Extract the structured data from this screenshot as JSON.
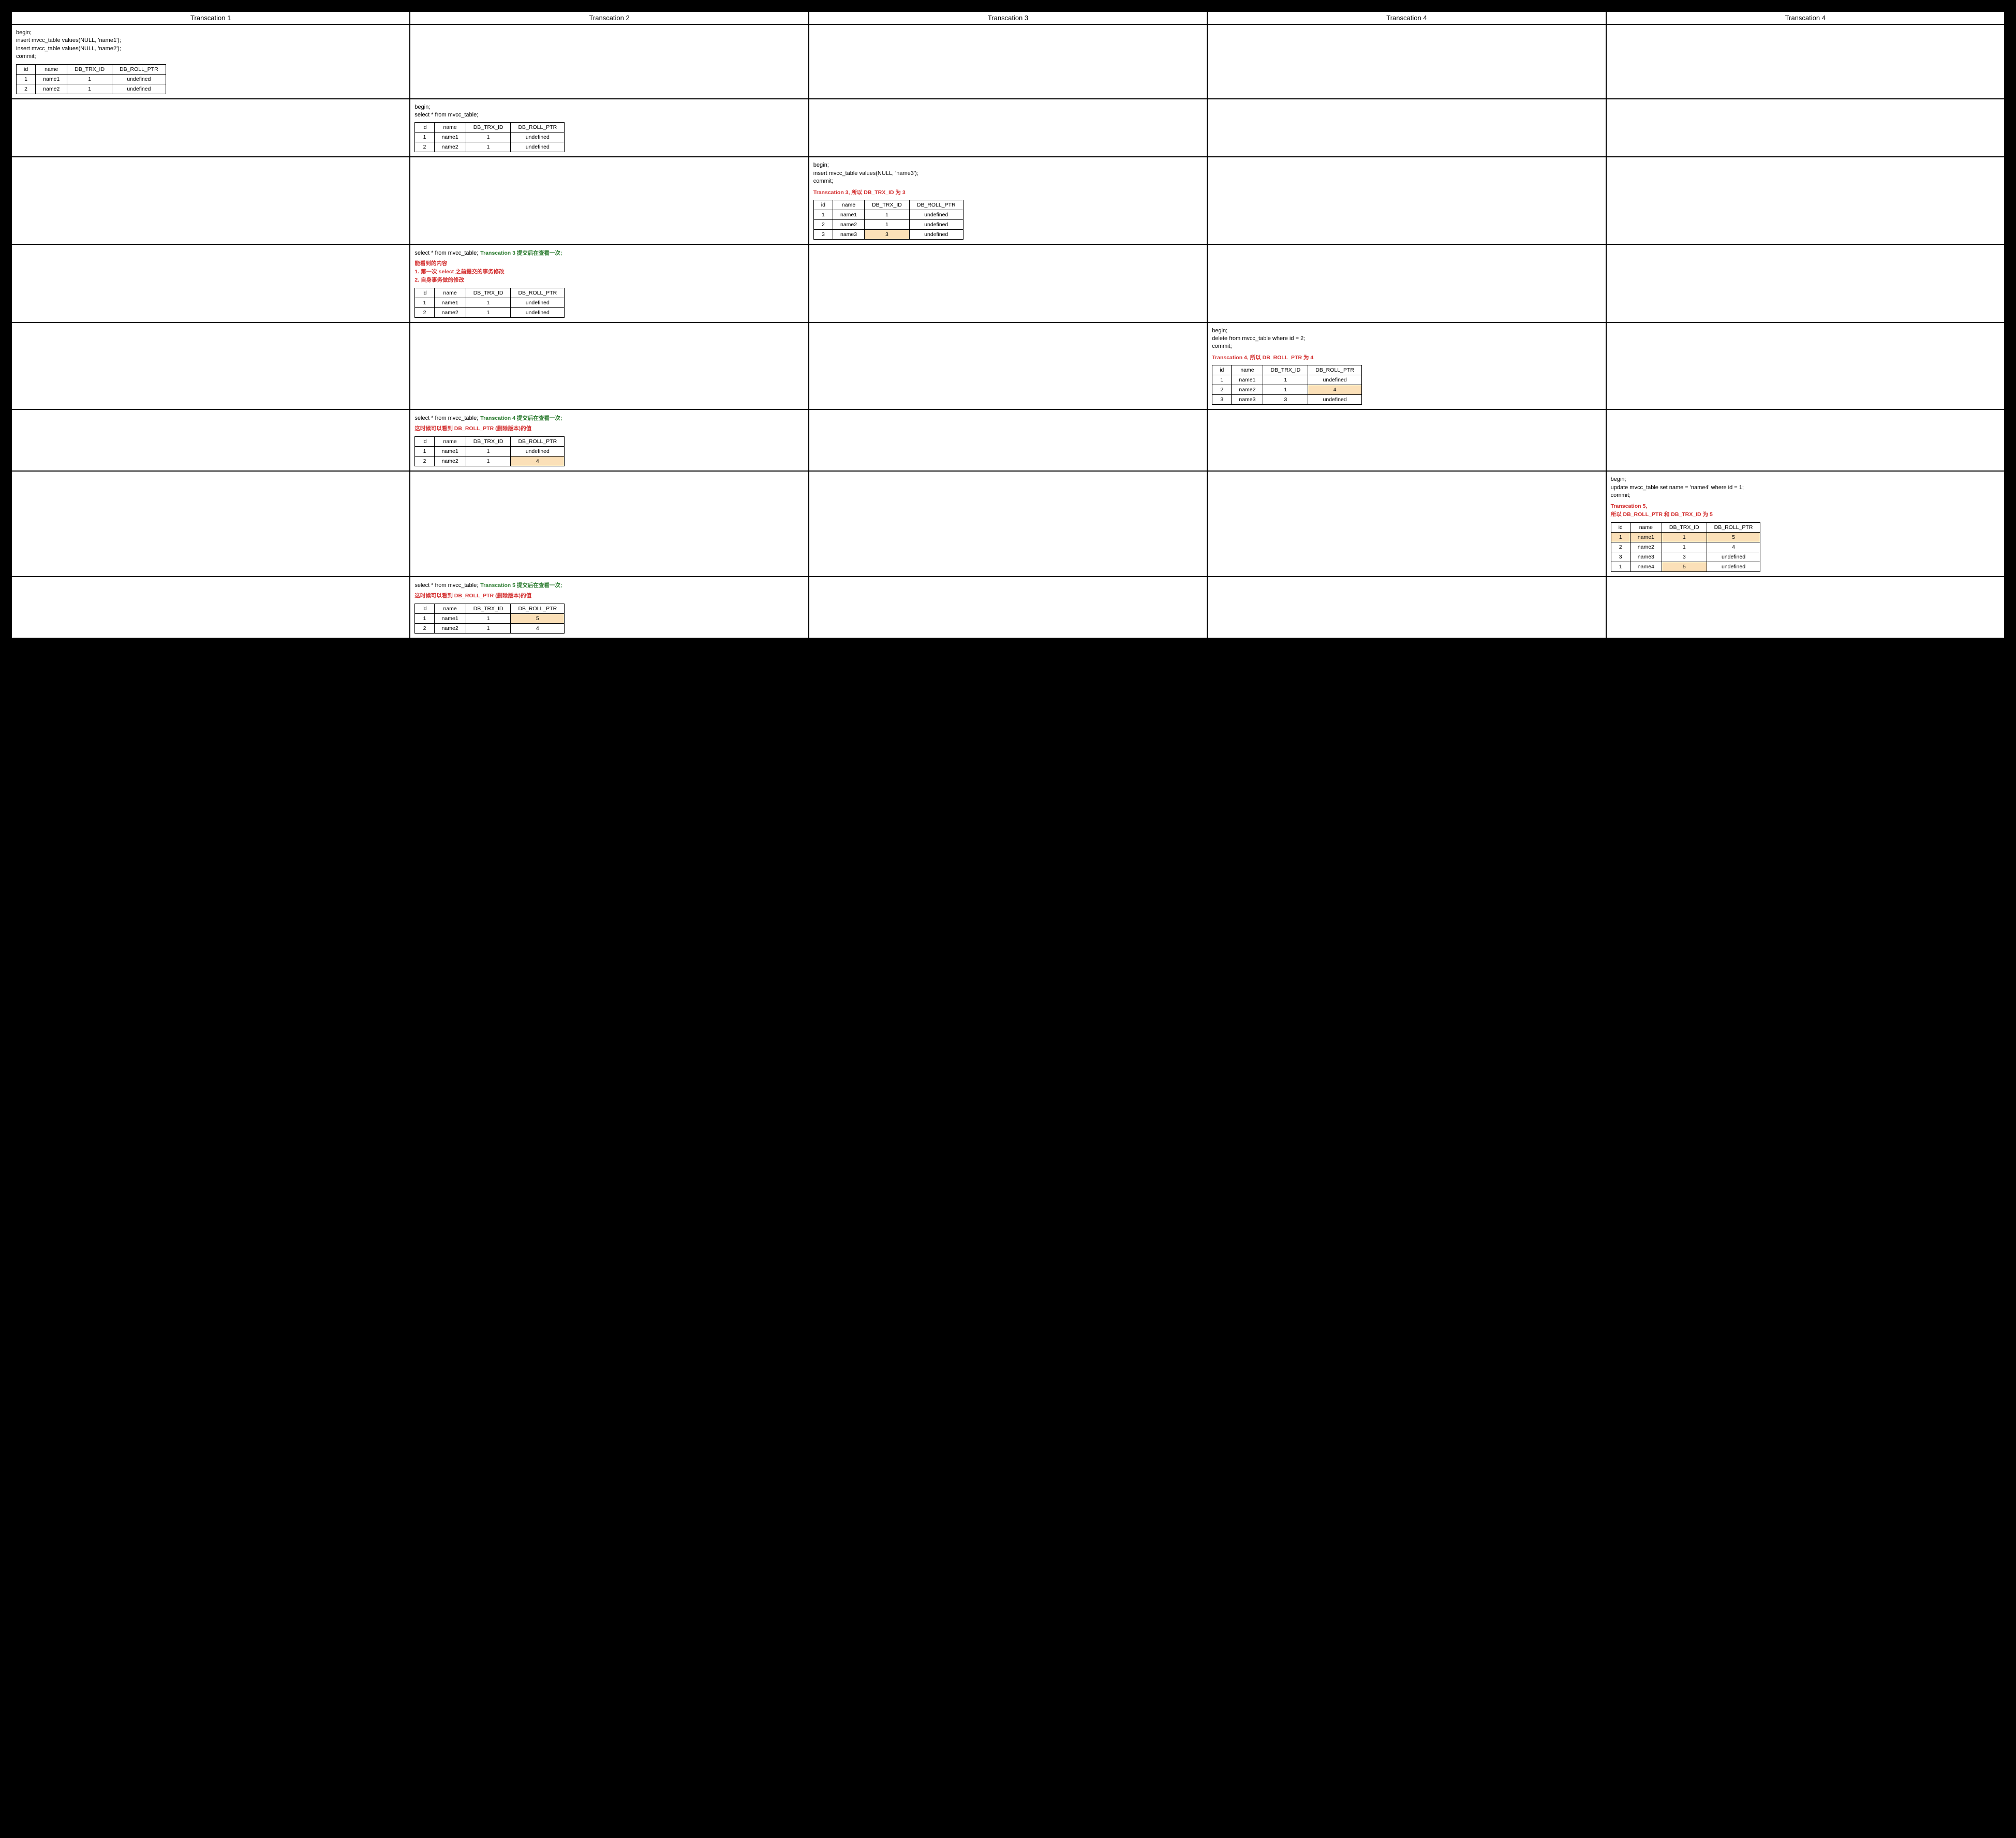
{
  "headers": [
    "Transcation 1",
    "Transcation 2",
    "Transcation 3",
    "Transcation 4",
    "Transcation 4"
  ],
  "tbl_headers": [
    "id",
    "name",
    "DB_TRX_ID",
    "DB_ROLL_PTR"
  ],
  "rows": [
    {
      "cells": [
        {
          "sql": "begin;\ninsert mvcc_table values(NULL, 'name1');\ninsert mvcc_table values(NULL, 'name2');\ncommit;",
          "table": [
            [
              "1",
              "name1",
              "1",
              "undefined"
            ],
            [
              "2",
              "name2",
              "1",
              "undefined"
            ]
          ]
        },
        {},
        {},
        {},
        {}
      ]
    },
    {
      "cells": [
        {},
        {
          "sql": "begin;\nselect * from mvcc_table;",
          "table": [
            [
              "1",
              "name1",
              "1",
              "undefined"
            ],
            [
              "2",
              "name2",
              "1",
              "undefined"
            ]
          ]
        },
        {},
        {},
        {}
      ]
    },
    {
      "cells": [
        {},
        {},
        {
          "sql": "begin;\ninsert mvcc_table values(NULL, 'name3');\ncommit;",
          "note_red": "Transcation 3, 所以 DB_TRX_ID 为 3",
          "table": [
            [
              "1",
              "name1",
              "1",
              "undefined"
            ],
            [
              "2",
              "name2",
              "1",
              "undefined"
            ],
            [
              "3",
              "name3",
              "3",
              "undefined"
            ]
          ],
          "highlights": [
            [
              2,
              2
            ]
          ]
        },
        {},
        {}
      ]
    },
    {
      "cells": [
        {},
        {
          "sql_inline": "select * from mvcc_table;",
          "note_green": "Transcation 3 提交后在查看一次;",
          "note_red": "能看到的内容\n1. 第一次 select 之前提交的事务修改\n2. 自身事务做的修改",
          "table": [
            [
              "1",
              "name1",
              "1",
              "undefined"
            ],
            [
              "2",
              "name2",
              "1",
              "undefined"
            ]
          ]
        },
        {},
        {},
        {}
      ]
    },
    {
      "cells": [
        {},
        {},
        {},
        {
          "sql": "begin;\ndelete from mvcc_table where id = 2;\ncommit;",
          "note_red": "Transcation 4, 所以 DB_ROLL_PTR 为 4",
          "table": [
            [
              "1",
              "name1",
              "1",
              "undefined"
            ],
            [
              "2",
              "name2",
              "1",
              "4"
            ],
            [
              "3",
              "name3",
              "3",
              "undefined"
            ]
          ],
          "highlights": [
            [
              1,
              3
            ]
          ]
        },
        {}
      ]
    },
    {
      "cells": [
        {},
        {
          "sql_inline": "select * from mvcc_table;",
          "note_green": "Transcation 4 提交后在查看一次;",
          "note_red": "这时候可以看到 DB_ROLL_PTR (删除版本)的值",
          "table": [
            [
              "1",
              "name1",
              "1",
              "undefined"
            ],
            [
              "2",
              "name2",
              "1",
              "4"
            ]
          ],
          "highlights": [
            [
              1,
              3
            ]
          ]
        },
        {},
        {},
        {}
      ]
    },
    {
      "cells": [
        {},
        {},
        {},
        {},
        {
          "sql": "begin;\nupdate mvcc_table set name = 'name4' where id = 1;\ncommit;",
          "note_red": "Transcation 5,\n所以 DB_ROLL_PTR 和 DB_TRX_ID 为 5",
          "table": [
            [
              "1",
              "name1",
              "1",
              "5"
            ],
            [
              "2",
              "name2",
              "1",
              "4"
            ],
            [
              "3",
              "name3",
              "3",
              "undefined"
            ],
            [
              "1",
              "name4",
              "5",
              "undefined"
            ]
          ],
          "highlights": [
            [
              0,
              0
            ],
            [
              0,
              1
            ],
            [
              0,
              2
            ],
            [
              0,
              3
            ],
            [
              3,
              2
            ]
          ]
        }
      ]
    },
    {
      "cells": [
        {},
        {
          "sql_inline": "select * from mvcc_table;",
          "note_green": "Transcation 5 提交后在查看一次;",
          "note_red": "这时候可以看到 DB_ROLL_PTR (删除版本)的值",
          "table": [
            [
              "1",
              "name1",
              "1",
              "5"
            ],
            [
              "2",
              "name2",
              "1",
              "4"
            ]
          ],
          "highlights": [
            [
              0,
              3
            ]
          ]
        },
        {},
        {},
        {}
      ]
    }
  ]
}
